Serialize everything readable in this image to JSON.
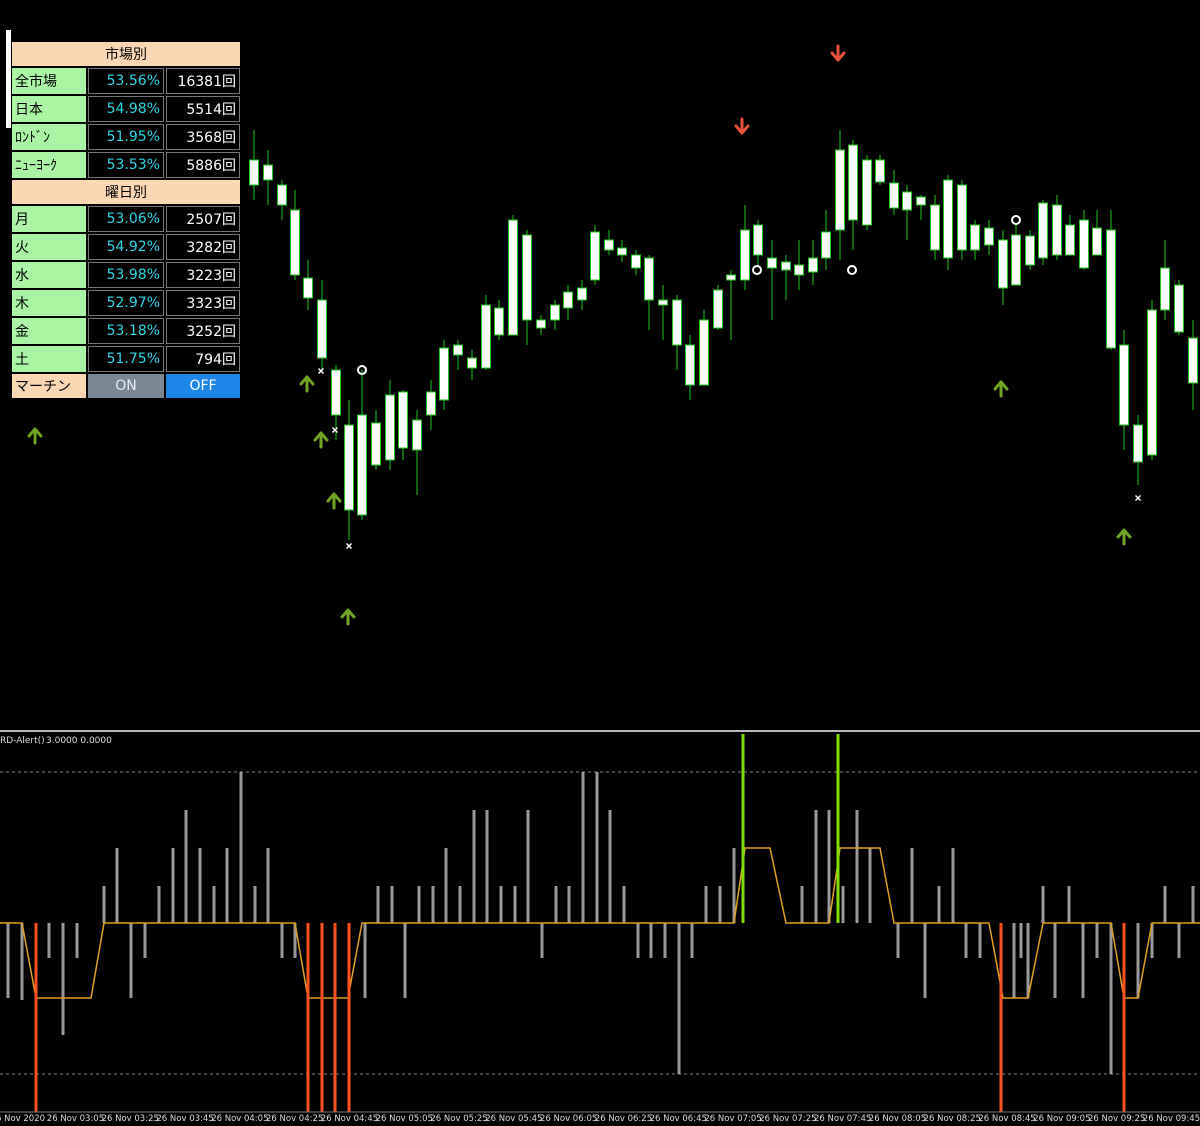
{
  "stats_panel": {
    "market_header": "市場別",
    "markets": [
      {
        "label": "全市場",
        "pct": "53.56%",
        "count": "16381回"
      },
      {
        "label": "日本",
        "pct": "54.98%",
        "count": "5514回"
      },
      {
        "label": "ﾛﾝﾄﾞﾝ",
        "pct": "51.95%",
        "count": "3568回"
      },
      {
        "label": "ﾆｭｰﾖｰｸ",
        "pct": "53.53%",
        "count": "5886回"
      }
    ],
    "weekday_header": "曜日別",
    "weekdays": [
      {
        "label": "月",
        "pct": "53.06%",
        "count": "2507回"
      },
      {
        "label": "火",
        "pct": "54.92%",
        "count": "3282回"
      },
      {
        "label": "水",
        "pct": "53.98%",
        "count": "3223回"
      },
      {
        "label": "木",
        "pct": "52.97%",
        "count": "3323回"
      },
      {
        "label": "金",
        "pct": "53.18%",
        "count": "3252回"
      },
      {
        "label": "土",
        "pct": "51.75%",
        "count": "794回"
      }
    ],
    "martingale_label": "マーチン",
    "on_label": "ON",
    "off_label": "OFF"
  },
  "indicator": {
    "name": "RD-Alert()",
    "values": "3.0000 0.0000"
  },
  "time_axis": [
    "6 Nov 2020",
    "26 Nov 03:05",
    "26 Nov 03:25",
    "26 Nov 03:45",
    "26 Nov 04:05",
    "26 Nov 04:25",
    "26 Nov 04:45",
    "26 Nov 05:05",
    "26 Nov 05:25",
    "26 Nov 05:45",
    "26 Nov 06:05",
    "26 Nov 06:25",
    "26 Nov 06:45",
    "26 Nov 07:05",
    "26 Nov 07:25",
    "26 Nov 07:45",
    "26 Nov 08:05",
    "26 Nov 08:25",
    "26 Nov 08:45",
    "26 Nov 09:05",
    "26 Nov 09:25",
    "26 Nov 09:45"
  ],
  "colors": {
    "bull_candle": "#ffffff",
    "wick": "#22c41e",
    "up_arrow": "#6fa520",
    "down_arrow": "#e8523a",
    "signal_green": "#7fe000",
    "signal_red": "#ff5020",
    "state_line": "#e0a020",
    "histogram": "#9a9a9a"
  }
}
